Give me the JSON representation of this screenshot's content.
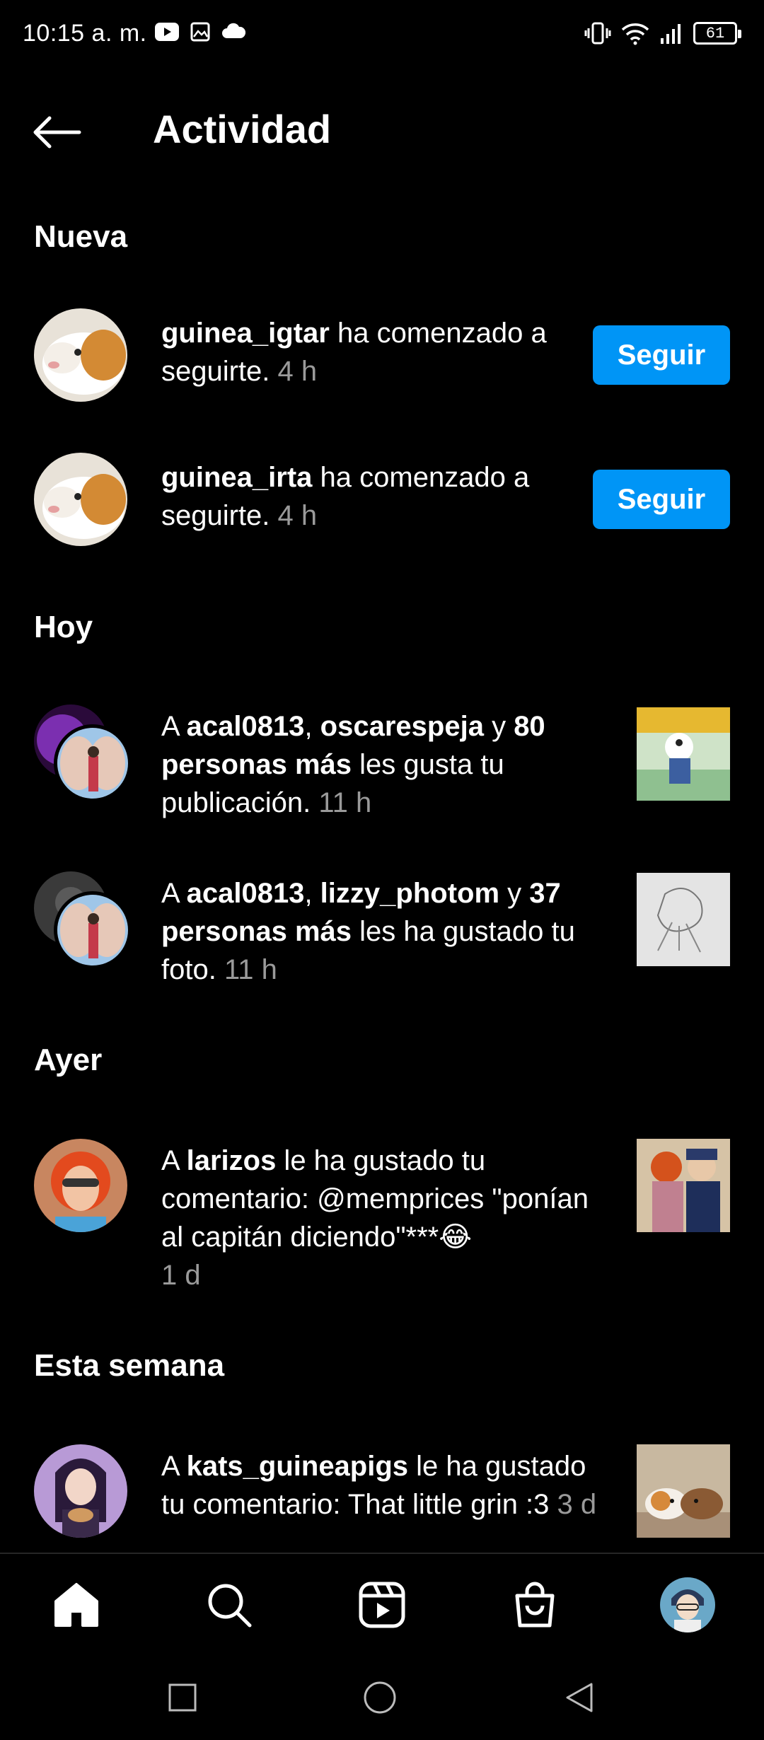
{
  "status_bar": {
    "time": "10:15 a. m.",
    "battery": "61",
    "icons_left": [
      "youtube-icon",
      "gallery-icon",
      "cloud-icon"
    ],
    "icons_right": [
      "vibrate-icon",
      "wifi-icon",
      "signal-icon",
      "battery-icon"
    ]
  },
  "header": {
    "title": "Actividad"
  },
  "sections": {
    "new": "Nueva",
    "today": "Hoy",
    "yesterday": "Ayer",
    "this_week": "Esta semana"
  },
  "new": [
    {
      "username": "guinea_igtar",
      "text": " ha comenzado a seguirte.",
      "time": "4 h",
      "button": "Seguir"
    },
    {
      "username": "guinea_irta",
      "text": " ha comenzado a seguirte.",
      "time": "4 h",
      "button": "Seguir"
    }
  ],
  "today": [
    {
      "prefix": "A ",
      "user1": "acal0813",
      "sep": ", ",
      "user2": "oscarespeja",
      "and": " y ",
      "others": "80 personas más",
      "text": " les gusta tu publicación.",
      "time": "11 h"
    },
    {
      "prefix": "A ",
      "user1": "acal0813",
      "sep": ", ",
      "user2": "lizzy_photom",
      "and": " y ",
      "others": "37 personas más",
      "text": " les ha gustado tu foto.",
      "time": "11 h"
    }
  ],
  "yesterday": [
    {
      "prefix": "A ",
      "user": "larizos",
      "text": " le ha gustado tu comentario: @memprices \"ponían al capitán diciendo\"***😂",
      "time": "1 d"
    }
  ],
  "this_week": [
    {
      "prefix": "A ",
      "user": "kats_guineapigs",
      "text": " le ha gustado tu comentario: That little grin :3",
      "time": "3 d"
    }
  ],
  "bottom_nav": [
    "home-icon",
    "search-icon",
    "reels-icon",
    "shop-icon",
    "profile-avatar"
  ],
  "colors": {
    "accent": "#0095f6",
    "background": "#000000",
    "muted_text": "#9a9a9a"
  }
}
